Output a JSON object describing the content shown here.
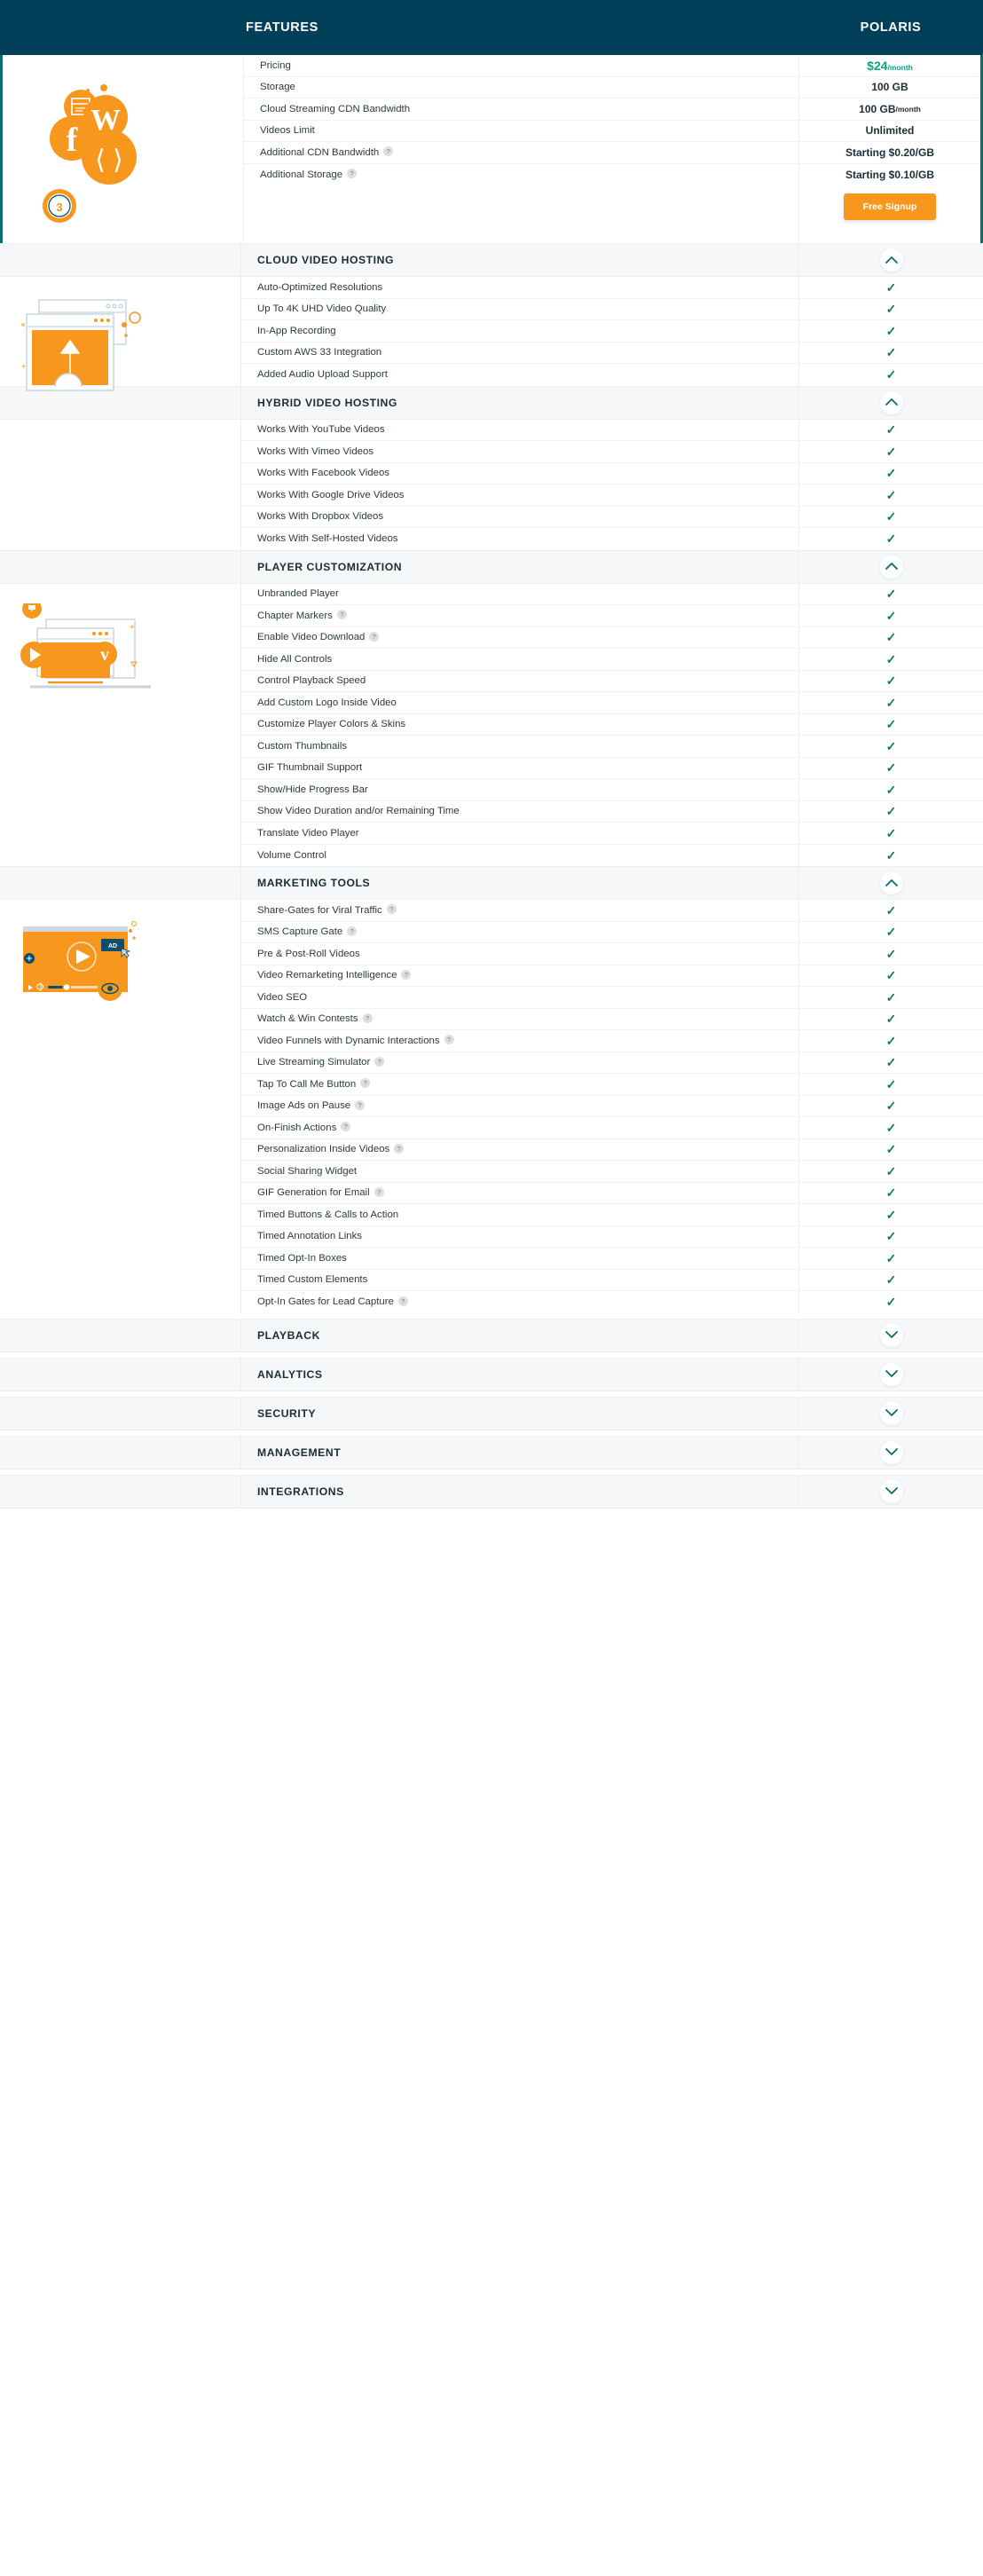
{
  "header": {
    "features_label": "FEATURES",
    "plan_label": "POLARIS"
  },
  "colors": {
    "header_bg": "#024059",
    "accent_orange": "#f7971d",
    "check_teal": "#0c7a72",
    "price_green": "#0aa37f",
    "highlight_border": "#0c6b6b"
  },
  "plan_summary": {
    "rows": [
      {
        "label": "Pricing",
        "help": false,
        "value": "$24",
        "value_suffix": "/month",
        "value_style": "price"
      },
      {
        "label": "Storage",
        "help": false,
        "value": "100 GB",
        "value_suffix": "",
        "value_style": "plain"
      },
      {
        "label": "Cloud Streaming CDN Bandwidth",
        "help": false,
        "value": "100 GB",
        "value_suffix": "/month",
        "value_style": "plain"
      },
      {
        "label": "Videos Limit",
        "help": false,
        "value": "Unlimited",
        "value_suffix": "",
        "value_style": "plain"
      },
      {
        "label": "Additional CDN Bandwidth",
        "help": true,
        "value": "Starting $0.20/GB",
        "value_suffix": "",
        "value_style": "plain"
      },
      {
        "label": "Additional Storage",
        "help": true,
        "value": "Starting $0.10/GB",
        "value_suffix": "",
        "value_style": "plain"
      }
    ],
    "signup_label": "Free Signup"
  },
  "sections": [
    {
      "title": "CLOUD VIDEO HOSTING",
      "expanded": true,
      "illustration": "cloud-upload-illustration",
      "items": [
        {
          "label": "Auto-Optimized Resolutions",
          "help": false,
          "value": "check"
        },
        {
          "label": "Up To 4K UHD Video Quality",
          "help": false,
          "value": "check"
        },
        {
          "label": "In-App Recording",
          "help": false,
          "value": "check"
        },
        {
          "label": "Custom AWS 33 Integration",
          "help": false,
          "value": "check"
        },
        {
          "label": "Added Audio Upload Support",
          "help": false,
          "value": "check"
        }
      ]
    },
    {
      "title": "HYBRID VIDEO HOSTING",
      "expanded": true,
      "illustration": "none",
      "items": [
        {
          "label": "Works With YouTube Videos",
          "help": false,
          "value": "check"
        },
        {
          "label": "Works With Vimeo Videos",
          "help": false,
          "value": "check"
        },
        {
          "label": "Works With Facebook Videos",
          "help": false,
          "value": "check"
        },
        {
          "label": "Works With Google Drive Videos",
          "help": false,
          "value": "check"
        },
        {
          "label": "Works With Dropbox Videos",
          "help": false,
          "value": "check"
        },
        {
          "label": "Works With Self-Hosted Videos",
          "help": false,
          "value": "check"
        }
      ]
    },
    {
      "title": "PLAYER CUSTOMIZATION",
      "expanded": true,
      "illustration": "laptop-player-illustration",
      "items": [
        {
          "label": "Unbranded Player",
          "help": false,
          "value": "check"
        },
        {
          "label": "Chapter Markers",
          "help": true,
          "value": "check"
        },
        {
          "label": "Enable Video Download",
          "help": true,
          "value": "check"
        },
        {
          "label": "Hide All Controls",
          "help": false,
          "value": "check"
        },
        {
          "label": "Control Playback Speed",
          "help": false,
          "value": "check"
        },
        {
          "label": "Add Custom Logo Inside Video",
          "help": false,
          "value": "check"
        },
        {
          "label": "Customize Player Colors & Skins",
          "help": false,
          "value": "check"
        },
        {
          "label": "Custom Thumbnails",
          "help": false,
          "value": "check"
        },
        {
          "label": "GIF Thumbnail Support",
          "help": false,
          "value": "check"
        },
        {
          "label": "Show/Hide Progress Bar",
          "help": false,
          "value": "check"
        },
        {
          "label": "Show Video Duration and/or Remaining Time",
          "help": false,
          "value": "check"
        },
        {
          "label": "Translate Video Player",
          "help": false,
          "value": "check"
        },
        {
          "label": "Volume Control",
          "help": false,
          "value": "check"
        }
      ]
    },
    {
      "title": "MARKETING TOOLS",
      "expanded": true,
      "illustration": "video-ad-illustration",
      "items": [
        {
          "label": "Share-Gates for Viral Traffic",
          "help": true,
          "value": "check"
        },
        {
          "label": "SMS Capture Gate",
          "help": true,
          "value": "check"
        },
        {
          "label": "Pre & Post-Roll Videos",
          "help": false,
          "value": "check"
        },
        {
          "label": "Video Remarketing Intelligence",
          "help": true,
          "value": "check"
        },
        {
          "label": "Video SEO",
          "help": false,
          "value": "check"
        },
        {
          "label": "Watch & Win Contests",
          "help": true,
          "value": "check"
        },
        {
          "label": "Video Funnels with Dynamic Interactions",
          "help": true,
          "value": "check"
        },
        {
          "label": "Live Streaming Simulator",
          "help": true,
          "value": "check"
        },
        {
          "label": "Tap To Call Me Button",
          "help": true,
          "value": "check"
        },
        {
          "label": "Image Ads on Pause",
          "help": true,
          "value": "check"
        },
        {
          "label": "On-Finish Actions",
          "help": true,
          "value": "check"
        },
        {
          "label": "Personalization Inside Videos",
          "help": true,
          "value": "check"
        },
        {
          "label": "Social Sharing Widget",
          "help": false,
          "value": "check"
        },
        {
          "label": "GIF Generation for Email",
          "help": true,
          "value": "check"
        },
        {
          "label": "Timed Buttons & Calls to Action",
          "help": false,
          "value": "check"
        },
        {
          "label": "Timed Annotation Links",
          "help": false,
          "value": "check"
        },
        {
          "label": "Timed Opt-In Boxes",
          "help": false,
          "value": "check"
        },
        {
          "label": "Timed Custom Elements",
          "help": false,
          "value": "check"
        },
        {
          "label": "Opt-In Gates for Lead Capture",
          "help": true,
          "value": "check"
        }
      ]
    }
  ],
  "collapsed_sections": [
    {
      "title": "PLAYBACK",
      "expanded": false
    },
    {
      "title": "ANALYTICS",
      "expanded": false
    },
    {
      "title": "SECURITY",
      "expanded": false
    },
    {
      "title": "MANAGEMENT",
      "expanded": false
    },
    {
      "title": "INTEGRATIONS",
      "expanded": false
    }
  ]
}
